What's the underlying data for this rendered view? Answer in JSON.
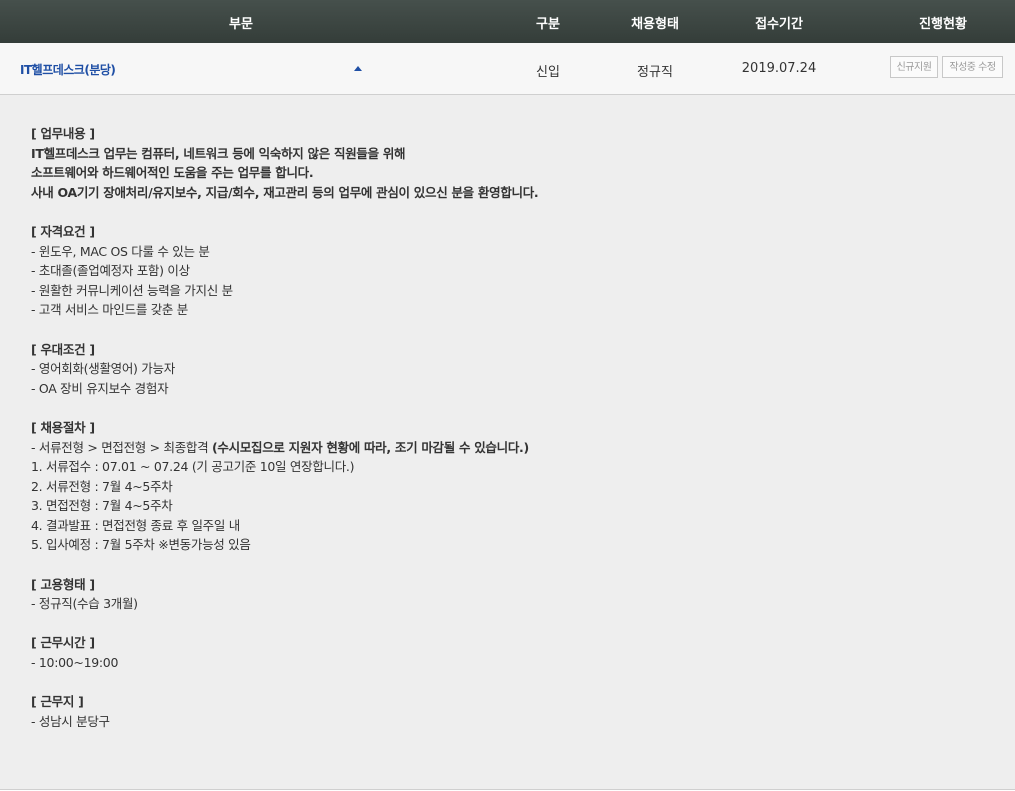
{
  "header": {
    "columns": [
      "부문",
      "구분",
      "채용형태",
      "접수기간",
      "진행현황"
    ]
  },
  "job": {
    "title": "IT헬프데스크(분당)",
    "type": "신입",
    "employment": "정규직",
    "period": "2019.07.24",
    "buttons": {
      "apply": "신규지원",
      "edit": "작성중 수정"
    }
  },
  "detail": {
    "duty_heading": "[ 업무내용 ]",
    "duty_lines": [
      "IT헬프데스크 업무는 컴퓨터, 네트워크 등에 익숙하지 않은 직원들을 위해",
      "소프트웨어와 하드웨어적인 도움을 주는 업무를 합니다.",
      "사내 OA기기 장애처리/유지보수, 지급/회수, 재고관리 등의 업무에 관심이 있으신 분을 환영합니다."
    ],
    "qual_heading": "[ 자격요건 ]",
    "qual_lines": [
      "- 윈도우, MAC OS 다룰 수 있는 분",
      "- 초대졸(졸업예정자 포함) 이상",
      "- 원활한 커뮤니케이션 능력을 가지신 분",
      "- 고객 서비스 마인드를 갖춘 분"
    ],
    "pref_heading": "[ 우대조건 ]",
    "pref_lines": [
      "- 영어회화(생활영어) 가능자",
      "- OA 장비 유지보수 경험자"
    ],
    "proc_heading": "[ 채용절차 ]",
    "proc_first_plain": "- 서류전형 > 면접전형 > 최종합격 ",
    "proc_first_bold": "(수시모집으로 지원자 현황에 따라, 조기 마감될 수 있습니다.)",
    "proc_lines": [
      "1. 서류접수 : 07.01 ~ 07.24 (기 공고기준 10일 연장합니다.)",
      "2. 서류전형 : 7월 4~5주차",
      "3. 면접전형 : 7월 4~5주차",
      "4. 결과발표 : 면접전형 종료 후 일주일 내",
      "5. 입사예정 : 7월 5주차 ※변동가능성 있음"
    ],
    "emp_heading": "[ 고용형태 ]",
    "emp_lines": [
      "- 정규직(수습 3개월)"
    ],
    "hours_heading": "[ 근무시간 ]",
    "hours_lines": [
      "- 10:00~19:00"
    ],
    "loc_heading": "[ 근무지 ]",
    "loc_lines": [
      "- 성남시 분당구"
    ]
  }
}
